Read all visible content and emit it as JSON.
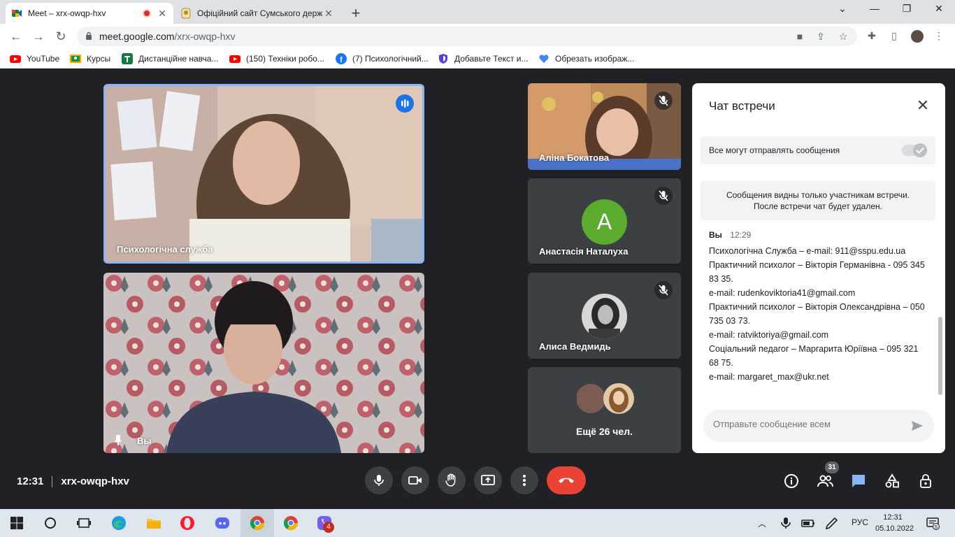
{
  "browser": {
    "tabs": [
      {
        "title": "Meet – xrx-owqp-hxv",
        "active": true
      },
      {
        "title": "Офіційний сайт Сумського держ",
        "active": false
      }
    ],
    "url_host": "meet.google.com",
    "url_path": "/xrx-owqp-hxv",
    "bookmarks": [
      {
        "label": "YouTube",
        "icon": "youtube-icon"
      },
      {
        "label": "Курсы",
        "icon": "classroom-icon"
      },
      {
        "label": "Дистанційне навча...",
        "icon": "moodle-icon"
      },
      {
        "label": "(150) Техніки робо...",
        "icon": "youtube-icon"
      },
      {
        "label": "(7) Психологічний...",
        "icon": "facebook-icon"
      },
      {
        "label": "Добавьте Текст и...",
        "icon": "shield-icon"
      },
      {
        "label": "Обрезать изображ...",
        "icon": "heart-icon"
      }
    ]
  },
  "meet": {
    "participants": [
      {
        "name": "Психологічна служба"
      },
      {
        "name": "Вы"
      },
      {
        "name": "Аліна Бокатова"
      },
      {
        "name": "Анастасія Наталуха",
        "initial": "A"
      },
      {
        "name": "Алиса Ведмидь"
      }
    ],
    "more_label": "Ещё 26 чел.",
    "time": "12:31",
    "meeting_code": "xrx-owqp-hxv",
    "people_count": "31"
  },
  "chat": {
    "title": "Чат встречи",
    "toggle_label": "Все могут отправлять сообщения",
    "notice_line1": "Сообщения видны только участникам встречи.",
    "notice_line2": "После встречи чат будет удален.",
    "message": {
      "sender": "Вы",
      "time": "12:29",
      "lines": [
        "Психологічна Служба – e-mail: 911@sspu.edu.ua",
        "Практичний психолог – Вікторія Германівна - 095 345 83 35.",
        "e-mail: rudenkoviktoria41@gmail.com",
        "Практичний психолог – Вікторія Олександрівна – 050 735 03 73.",
        "e-mail: ratviktoriya@gmail.com",
        "Соціальний педагог – Маргарита Юріївна – 095 321 68 75.",
        "e-mail: margaret_max@ukr.net"
      ]
    },
    "input_placeholder": "Отправьте сообщение всем"
  },
  "taskbar": {
    "lang": "РУС",
    "time": "12:31",
    "date": "05.10.2022",
    "viber_badge": "4",
    "notif_count": "5"
  },
  "colors": {
    "meet_bg": "#202124",
    "accent_blue": "#1a73e8",
    "end_call_red": "#ea4335",
    "avatar_green": "#5aab2e"
  }
}
